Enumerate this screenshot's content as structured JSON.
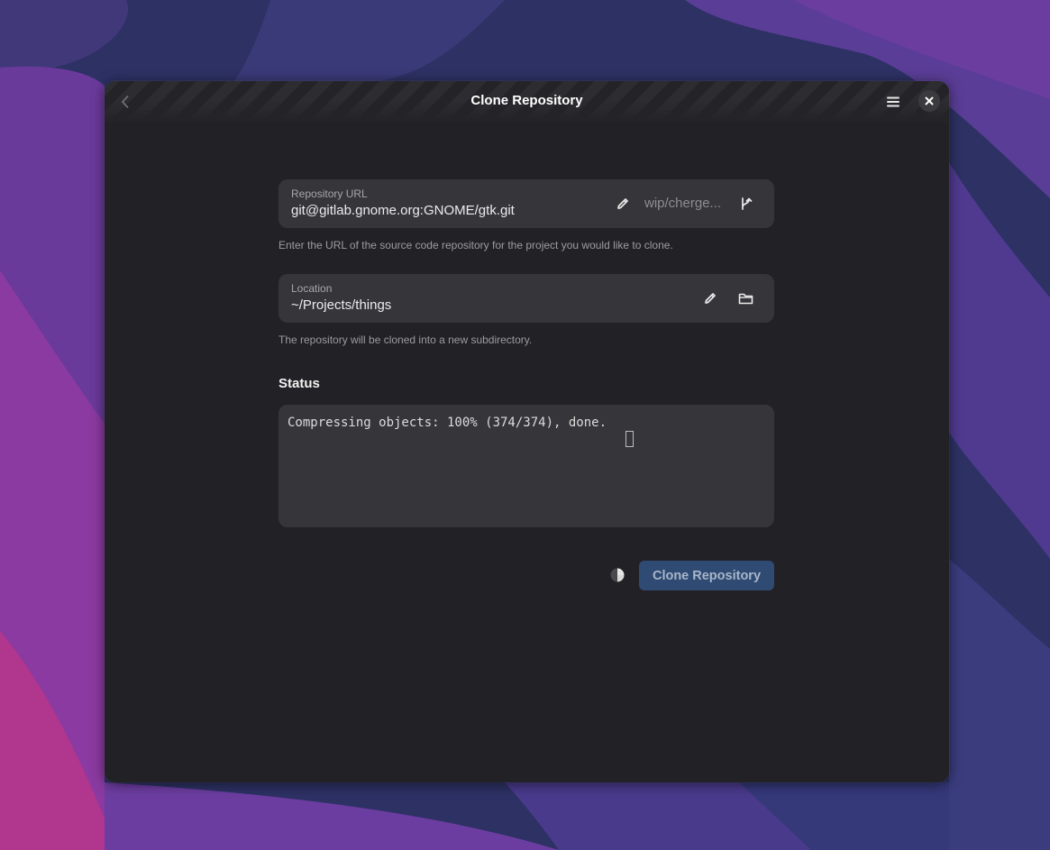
{
  "window": {
    "title": "Clone Repository"
  },
  "headerbar": {
    "back_icon": "go-previous-icon",
    "menu_icon": "hamburger-menu-icon",
    "close_icon": "close-icon"
  },
  "repository": {
    "label": "Repository URL",
    "value": "git@gitlab.gnome.org:GNOME/gtk.git",
    "branch": "wip/cherge...",
    "hint": "Enter the URL of the source code repository for the project you would like to clone.",
    "edit_icon": "pencil-icon",
    "branch_icon": "branch-icon"
  },
  "location": {
    "label": "Location",
    "value": "~/Projects/things",
    "hint": "The repository will be cloned into a new subdirectory.",
    "edit_icon": "pencil-icon",
    "folder_icon": "folder-icon"
  },
  "status": {
    "heading": "Status",
    "output": "Compressing objects: 100% (374/374), done."
  },
  "actions": {
    "clone_label": "Clone Repository",
    "spinner_icon": "progress-spinner-icon"
  },
  "colors": {
    "window_bg": "#222226",
    "row_bg": "#36363a",
    "button_bg": "#2f4a73"
  }
}
